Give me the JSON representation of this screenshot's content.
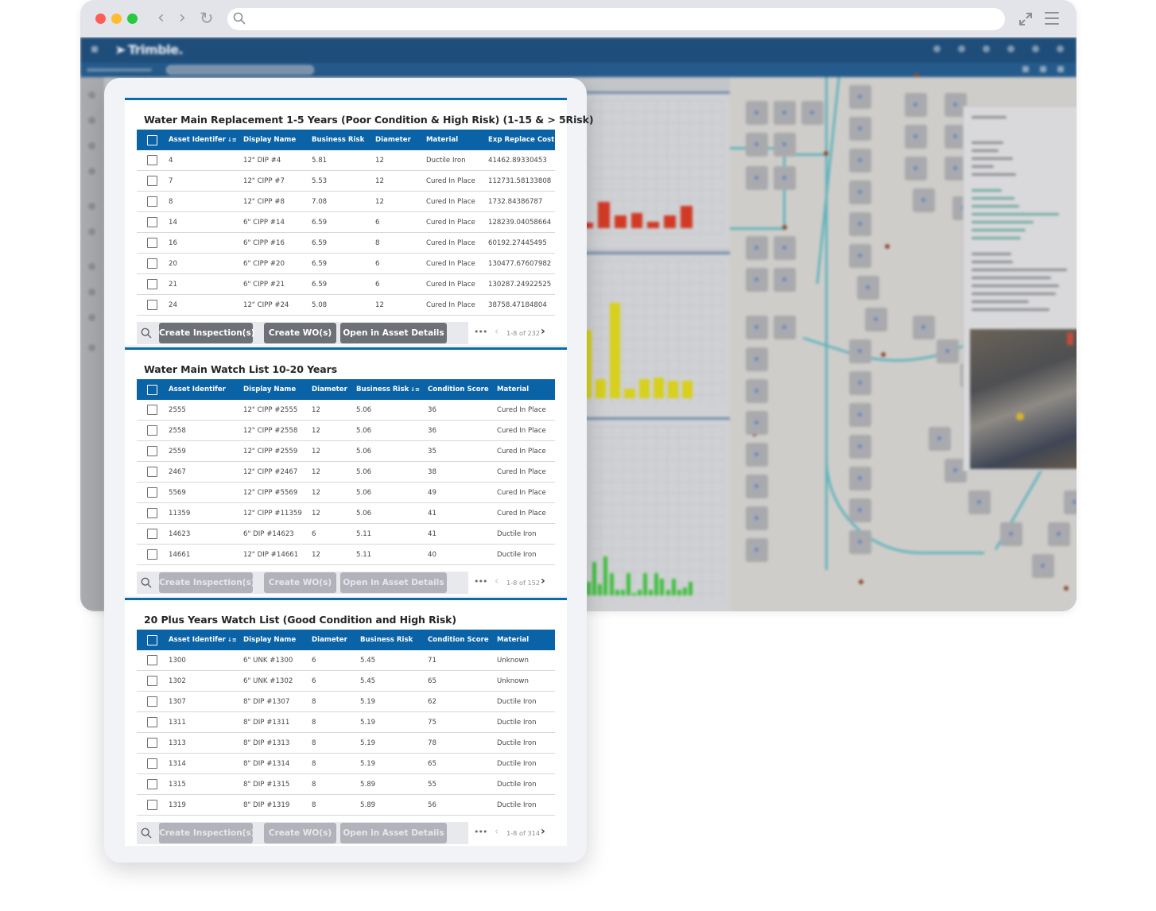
{
  "browser": {
    "url": "",
    "buttons": {
      "back": "‹",
      "forward": "›",
      "reload": "↻"
    }
  },
  "app": {
    "brand": "Trimble.",
    "icons": [
      "search-icon",
      "bell-icon",
      "help-icon",
      "settings-icon",
      "user-icon",
      "apps-icon"
    ]
  },
  "tables": [
    {
      "title": "Water Main Replacement 1-5 Years (Poor Condition & High Risk) (1-15 & > 5Risk)",
      "columns": [
        "Asset Identifer",
        "Display Name",
        "Business Risk",
        "Diameter",
        "Material",
        "Exp Replace Cost"
      ],
      "sorted_column": 0,
      "rows": [
        [
          "4",
          "12\" DIP #4",
          "5.81",
          "12",
          "Ductile Iron",
          "41462.89330453"
        ],
        [
          "7",
          "12\" CIPP #7",
          "5.53",
          "12",
          "Cured In Place",
          "112731.58133808"
        ],
        [
          "8",
          "12\" CIPP #8",
          "7.08",
          "12",
          "Cured In Place",
          "1732.84386787"
        ],
        [
          "14",
          "6\" CIPP #14",
          "6.59",
          "6",
          "Cured In Place",
          "128239.04058664"
        ],
        [
          "16",
          "6\" CIPP #16",
          "6.59",
          "8",
          "Cured In Place",
          "60192.27445495"
        ],
        [
          "20",
          "6\" CIPP #20",
          "6.59",
          "6",
          "Cured In Place",
          "130477.67607982"
        ],
        [
          "21",
          "6\" CIPP #21",
          "6.59",
          "6",
          "Cured In Place",
          "130287.24922525"
        ],
        [
          "24",
          "12\" CIPP #24",
          "5.08",
          "12",
          "Cured In Place",
          "38758.47184804"
        ]
      ],
      "actions": [
        "Create Inspection(s)",
        "Create WO(s)",
        "Open in Asset Details"
      ],
      "actions_enabled": true,
      "more": "•••",
      "pager": "1-8 of 232"
    },
    {
      "title": "Water Main Watch List 10-20 Years",
      "columns": [
        "Asset Identifer",
        "Display Name",
        "Diameter",
        "Business Risk",
        "Condition Score",
        "Material"
      ],
      "sorted_column": 3,
      "rows": [
        [
          "2555",
          "12\" CIPP #2555",
          "12",
          "5.06",
          "36",
          "Cured In Place"
        ],
        [
          "2558",
          "12\" CIPP #2558",
          "12",
          "5.06",
          "36",
          "Cured In Place"
        ],
        [
          "2559",
          "12\" CIPP #2559",
          "12",
          "5.06",
          "35",
          "Cured In Place"
        ],
        [
          "2467",
          "12\" CIPP #2467",
          "12",
          "5.06",
          "38",
          "Cured In Place"
        ],
        [
          "5569",
          "12\" CIPP #5569",
          "12",
          "5.06",
          "49",
          "Cured In Place"
        ],
        [
          "11359",
          "12\" CIPP #11359",
          "12",
          "5.06",
          "41",
          "Cured In Place"
        ],
        [
          "14623",
          "6\" DIP #14623",
          "6",
          "5.11",
          "41",
          "Ductile Iron"
        ],
        [
          "14661",
          "12\" DIP #14661",
          "12",
          "5.11",
          "40",
          "Ductile Iron"
        ]
      ],
      "actions": [
        "Create Inspection(s)",
        "Create WO(s)",
        "Open in Asset Details"
      ],
      "actions_enabled": false,
      "more": "•••",
      "pager": "1-8 of 152"
    },
    {
      "title": "20 Plus Years Watch List (Good Condition and High Risk)",
      "columns": [
        "Asset Identifer",
        "Display Name",
        "Diameter",
        "Business Risk",
        "Condition Score",
        "Material"
      ],
      "sorted_column": 0,
      "rows": [
        [
          "1300",
          "6\" UNK #1300",
          "6",
          "5.45",
          "71",
          "Unknown"
        ],
        [
          "1302",
          "6\" UNK #1302",
          "6",
          "5.45",
          "65",
          "Unknown"
        ],
        [
          "1307",
          "8\" DIP #1307",
          "8",
          "5.19",
          "62",
          "Ductile Iron"
        ],
        [
          "1311",
          "8\" DIP #1311",
          "8",
          "5.19",
          "75",
          "Ductile Iron"
        ],
        [
          "1313",
          "8\" DIP #1313",
          "8",
          "5.19",
          "78",
          "Ductile Iron"
        ],
        [
          "1314",
          "8\" DIP #1314",
          "8",
          "5.19",
          "65",
          "Ductile Iron"
        ],
        [
          "1315",
          "8\" DIP #1315",
          "8",
          "5.89",
          "55",
          "Ductile Iron"
        ],
        [
          "1319",
          "8\" DIP #1319",
          "8",
          "5.89",
          "56",
          "Ductile Iron"
        ]
      ],
      "actions": [
        "Create Inspection(s)",
        "Create WO(s)",
        "Open in Asset Details"
      ],
      "actions_enabled": false,
      "more": "•••",
      "pager": "1-8 of 314"
    }
  ],
  "background_charts": {
    "red": {
      "color": "#d23a26",
      "relative_values": [
        0.15,
        0.72,
        0.35,
        0.42,
        0.18,
        0.35,
        0.6
      ]
    },
    "yellow": {
      "color": "#d7d01c",
      "relative_values": [
        0.72,
        0.2,
        1.0,
        0.1,
        0.2,
        0.22,
        0.18,
        0.18
      ]
    },
    "green": {
      "color": "#3fbf3f",
      "relative_values": [
        0.9,
        0.25,
        0.6,
        0.2,
        0.7,
        0.4,
        0.1,
        0.1,
        0.4,
        0.05,
        0.1,
        0.4,
        0.1,
        0.4,
        0.3,
        0.1,
        0.3,
        0.1,
        0.15,
        0.25
      ]
    }
  },
  "colors": {
    "table_header": "#0a63a6",
    "card_accent": "#0a6aab",
    "button_active": "#6e7078",
    "button_disabled": "#b2b3ba"
  }
}
